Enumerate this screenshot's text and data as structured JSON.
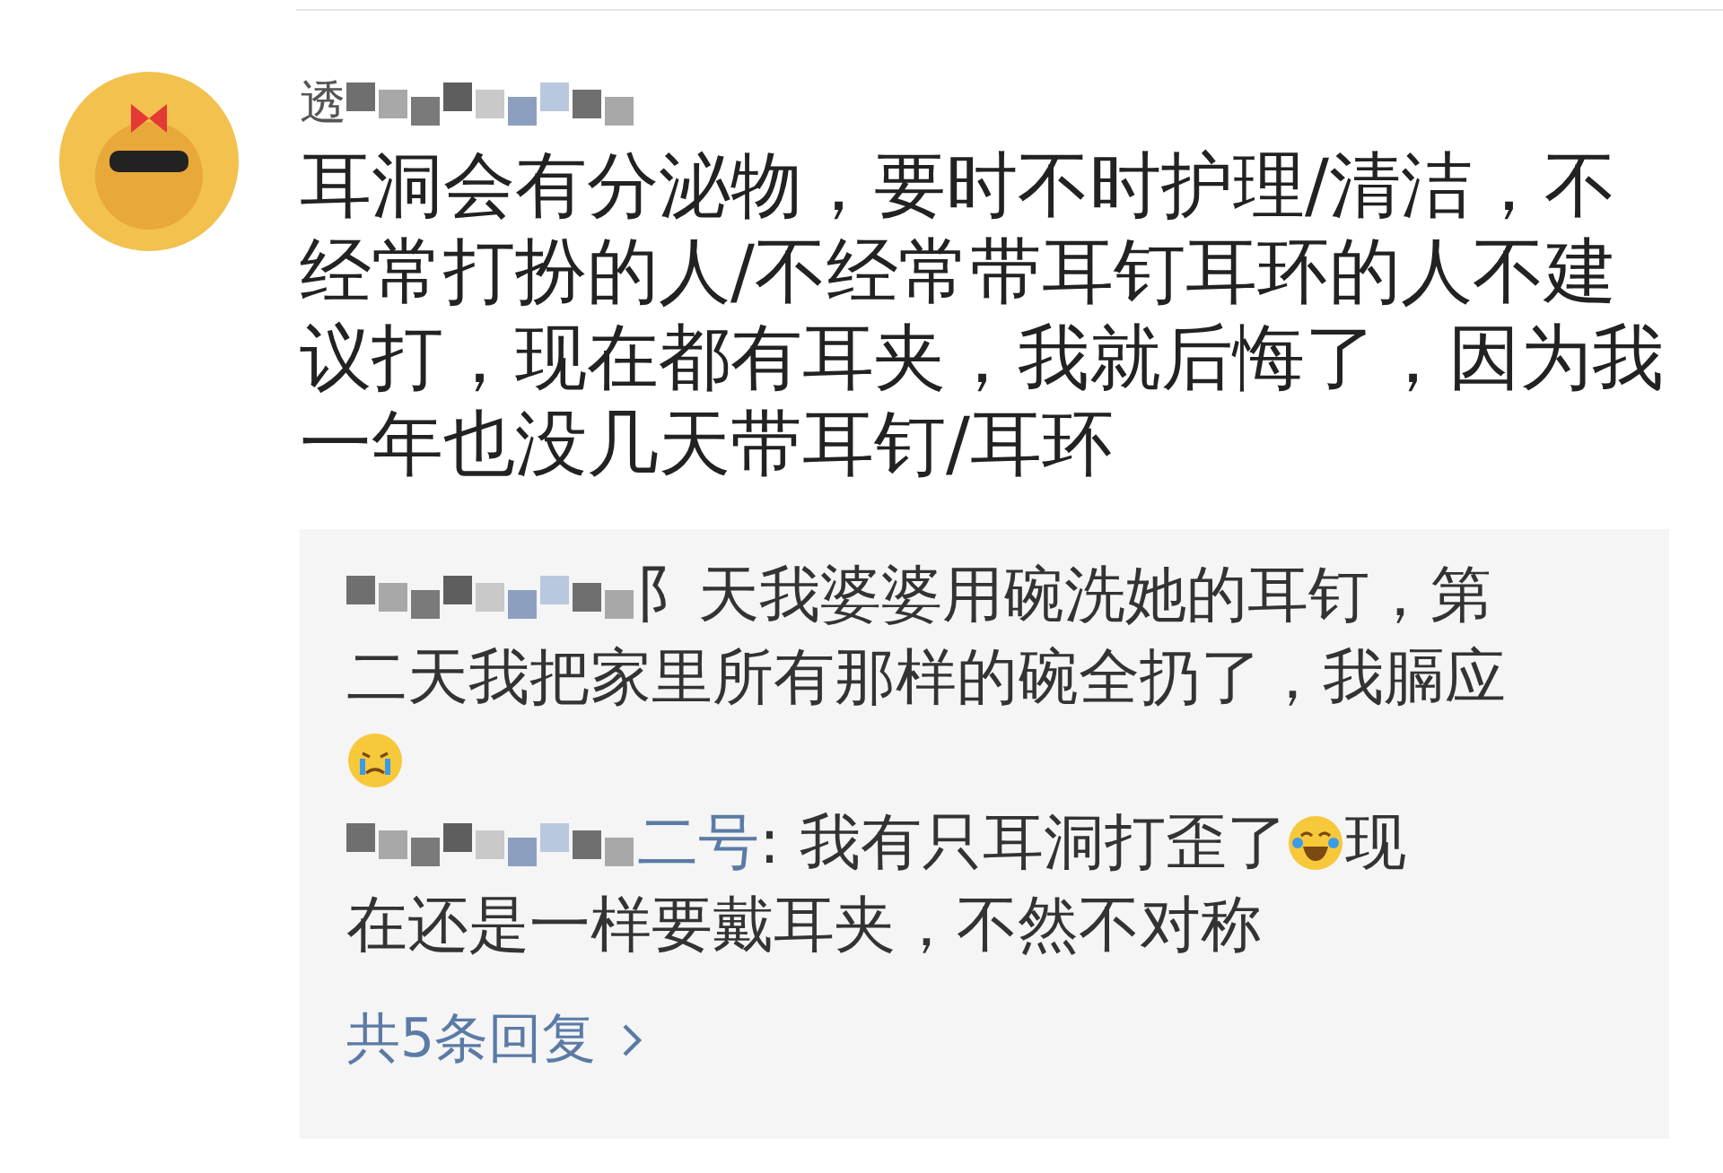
{
  "comment": {
    "author": [
      {
        "kind": "text",
        "text": "透"
      },
      {
        "kind": "mosaic"
      }
    ],
    "text": "耳洞会有分泌物，要时不时护理/清洁，不经常打扮的人/不经常带耳钉耳环的人不建议打，现在都有耳夹，我就后悔了，因为我一年也没几天带耳钉/耳环",
    "replies": [
      {
        "lines": [
          [
            {
              "kind": "mosaic"
            },
            {
              "kind": "text",
              "text": "阝天我婆婆用碗洗她的耳钉，第"
            }
          ],
          [
            {
              "kind": "text",
              "text": "二天我把家里所有那样的碗全扔了，我膈应"
            }
          ],
          [
            {
              "kind": "cry-emoji"
            }
          ]
        ]
      },
      {
        "lines": [
          [
            {
              "kind": "mosaic"
            },
            {
              "kind": "name",
              "text": "二号"
            },
            {
              "kind": "text",
              "text": ": 我有只耳洞打歪了"
            },
            {
              "kind": "laugh-emoji"
            },
            {
              "kind": "text",
              "text": "现"
            }
          ],
          [
            {
              "kind": "text",
              "text": "在还是一样要戴耳夹，不然不对称"
            }
          ]
        ]
      }
    ],
    "more_replies": "共5条回复"
  }
}
